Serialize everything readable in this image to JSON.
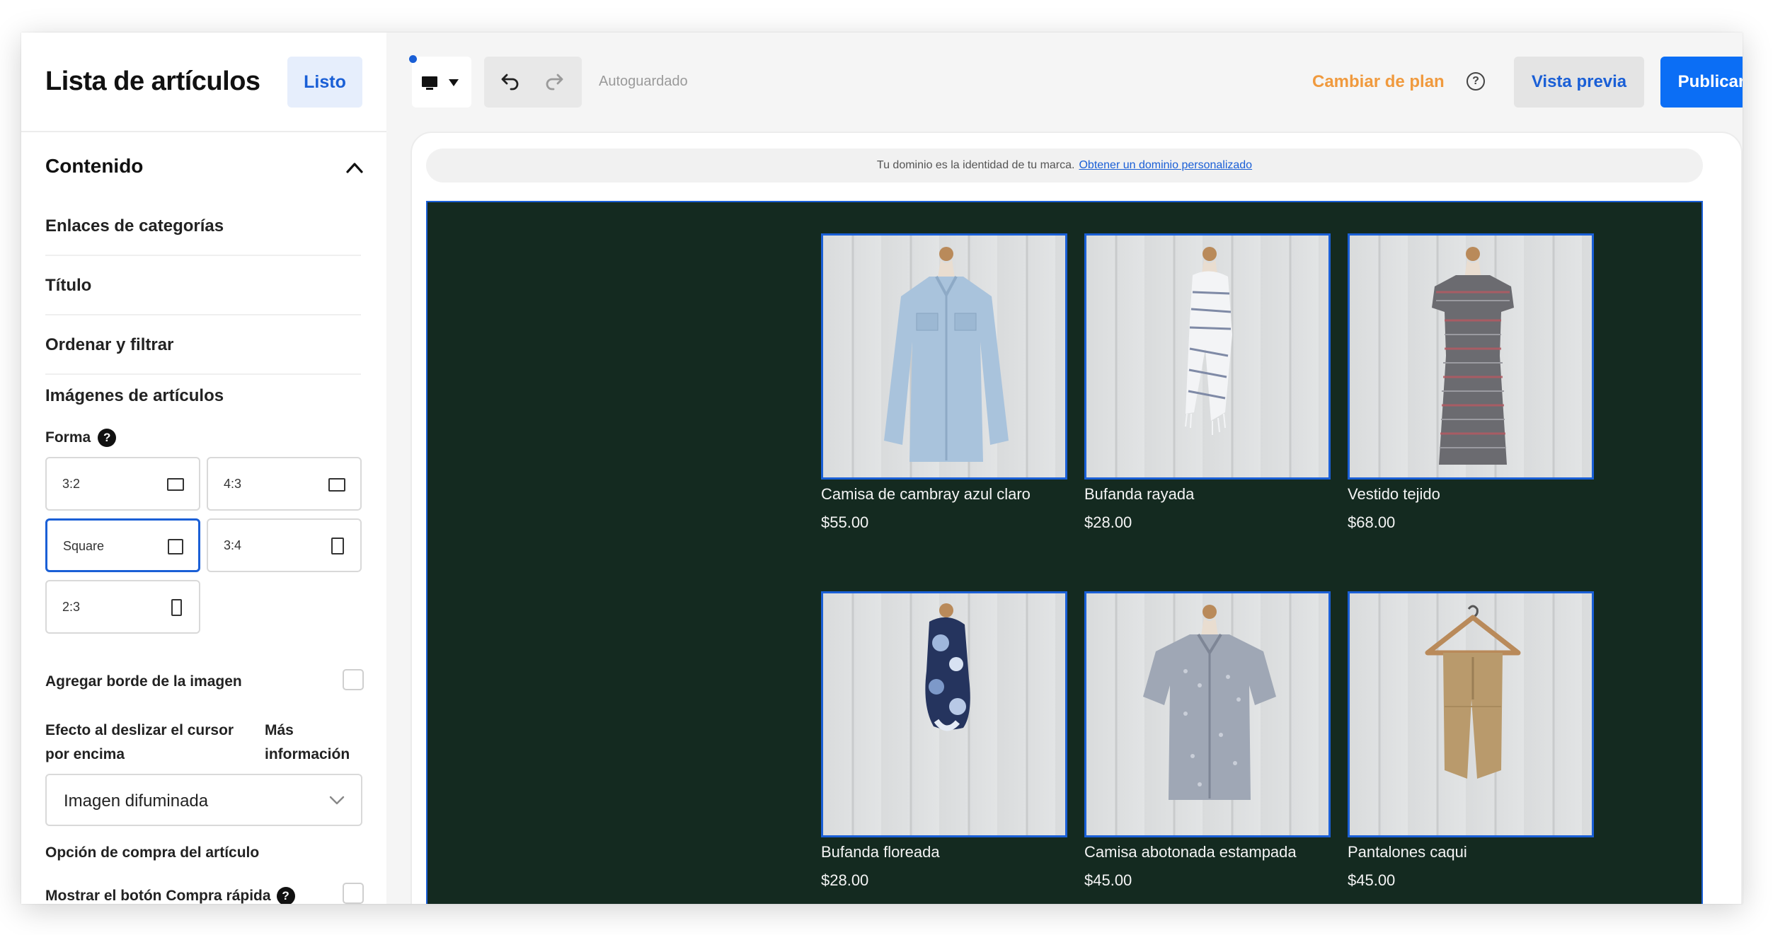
{
  "sidebar": {
    "title": "Lista de artículos",
    "done_label": "Listo",
    "section_title": "Contenido",
    "nav_items": [
      "Enlaces de categorías",
      "Título",
      "Ordenar y filtrar"
    ],
    "images_title": "Imágenes de artículos",
    "shape_label": "Forma",
    "help_glyph": "?",
    "shapes": [
      {
        "label": "3:2",
        "selected": false
      },
      {
        "label": "4:3",
        "selected": false
      },
      {
        "label": "Square",
        "selected": true
      },
      {
        "label": "3:4",
        "selected": false
      },
      {
        "label": "2:3",
        "selected": false
      }
    ],
    "border_label": "Agregar borde de la imagen",
    "border_checked": false,
    "hover_label": "Efecto al deslizar el cursor por encima",
    "hover_more": "Más información",
    "hover_value": "Imagen difuminada",
    "buy_title": "Opción de compra del artículo",
    "quick_buy_label": "Mostrar el botón Compra rápida",
    "quick_buy_checked": false
  },
  "toolbar": {
    "autosave": "Autoguardado",
    "upgrade": "Cambiar de plan",
    "help_glyph": "?",
    "preview": "Vista previa",
    "publish": "Publicar"
  },
  "canvas": {
    "domain_text": "Tu dominio es la identidad de tu marca.",
    "domain_link": "Obtener un dominio personalizado",
    "products": [
      {
        "name": "Camisa de cambray azul claro",
        "price": "$55.00",
        "image": "light-blue-shirt"
      },
      {
        "name": "Bufanda rayada",
        "price": "$28.00",
        "image": "striped-scarf"
      },
      {
        "name": "Vestido tejido",
        "price": "$68.00",
        "image": "knit-dress"
      },
      {
        "name": "Bufanda floreada",
        "price": "$28.00",
        "image": "floral-scarf"
      },
      {
        "name": "Camisa abotonada estampada",
        "price": "$45.00",
        "image": "printed-shirt"
      },
      {
        "name": "Pantalones caqui",
        "price": "$45.00",
        "image": "khaki-pants"
      }
    ]
  },
  "colors": {
    "accent": "#1a5fd6",
    "publish": "#0b6ef5",
    "upgrade": "#f09a3e",
    "site_background": "#142a20"
  }
}
